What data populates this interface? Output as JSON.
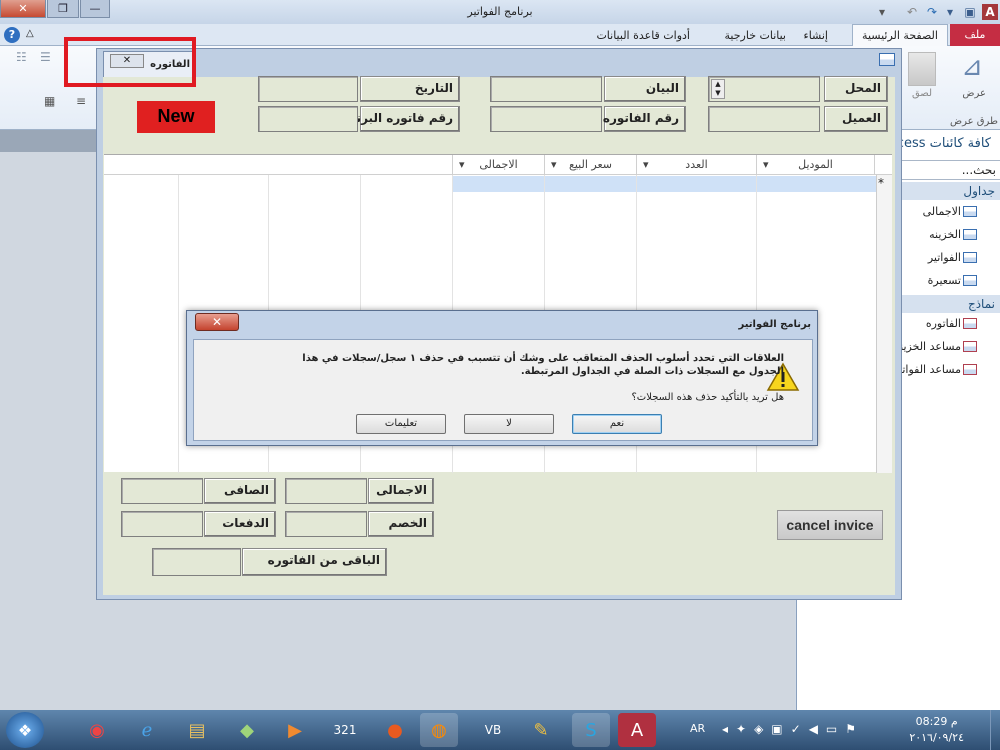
{
  "window": {
    "title": "برنامج الفواتير"
  },
  "tabs": {
    "file": "ملف",
    "home": "الصفحة الرئيسية",
    "create": "إنشاء",
    "external": "بيانات خارجية",
    "dbtools": "أدوات قاعدة البيانات"
  },
  "ribbon": {
    "view_label": "عرض",
    "paste_label": "لصق",
    "group_views": "طرق عرض"
  },
  "nav": {
    "header": "كافة كائنات Access",
    "search_placeholder": "بحث...",
    "sec_tables": "جداول",
    "tables": [
      "الاجمالى",
      "الخزينه",
      "الفواتير",
      "تسعيرة"
    ],
    "sec_forms": "نماذج",
    "forms": [
      "الفاتوره",
      "مساعد الخزينه",
      "مساعد الفواتير"
    ]
  },
  "form": {
    "tab_title": "الفاتوره",
    "new_button": "New",
    "lbl_place": "المحل",
    "lbl_desc": "البيان",
    "lbl_date": "التاريخ",
    "lbl_customer": "العميل",
    "lbl_invoice_no": "رقم الفاتوره",
    "lbl_program_invoice_no": "رقم فاتوره البرنامج",
    "grid_headers": [
      "الموديل",
      "العدد",
      "سعر البيع",
      "الاجمالى"
    ],
    "lbl_total": "الاجمالى",
    "lbl_net": "الصافى",
    "lbl_discount": "الخصم",
    "lbl_payments": "الدفعات",
    "lbl_remaining": "الباقى من الفاتوره",
    "cancel_button": "cancel invice"
  },
  "dialog": {
    "title": "برنامج الفواتير",
    "message": "العلاقات التي تحدد أسلوب الحذف المتعاقب على وشك أن تتسبب في حذف ١ سجل/سجلات في هذا الجدول مع السجلات ذات الصلة في الجداول المرتبطة.",
    "question": "هل تريد بالتأكيد حذف هذه السجلات؟",
    "yes": "نعم",
    "no": "لا",
    "help": "تعليمات"
  },
  "taskbar": {
    "lang": "AR",
    "time": "08:29 م",
    "date": "٢٠١٦/٠٩/٢٤"
  }
}
